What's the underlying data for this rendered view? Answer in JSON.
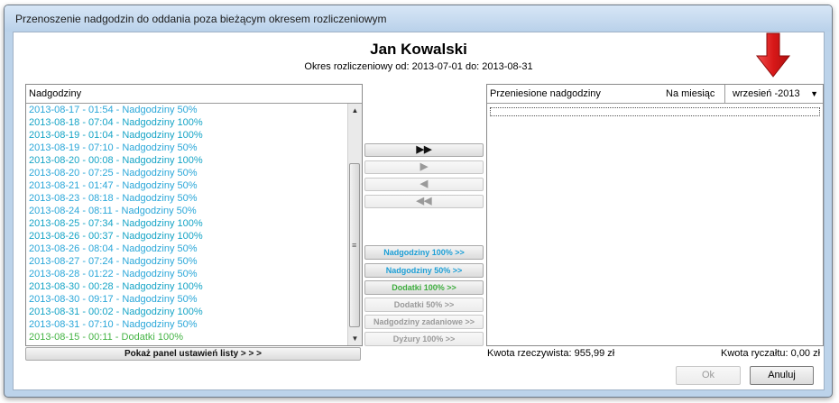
{
  "window": {
    "title": "Przenoszenie nadgodzin do oddania poza bieżącym okresem rozliczeniowym"
  },
  "header": {
    "name": "Jan Kowalski",
    "period": "Okres rozliczeniowy od: 2013-07-01 do: 2013-08-31"
  },
  "left_panel": {
    "title": "Nadgodziny",
    "items": [
      {
        "text": "2013-08-17 - 01:54 - Nadgodziny 50%",
        "kind": "c50"
      },
      {
        "text": "2013-08-18 - 07:04 - Nadgodziny 100%",
        "kind": "c100"
      },
      {
        "text": "2013-08-19 - 01:04 - Nadgodziny 100%",
        "kind": "c100"
      },
      {
        "text": "2013-08-19 - 07:10 - Nadgodziny 50%",
        "kind": "c50"
      },
      {
        "text": "2013-08-20 - 00:08 - Nadgodziny 100%",
        "kind": "c100"
      },
      {
        "text": "2013-08-20 - 07:25 - Nadgodziny 50%",
        "kind": "c50"
      },
      {
        "text": "2013-08-21 - 01:47 - Nadgodziny 50%",
        "kind": "c50"
      },
      {
        "text": "2013-08-23 - 08:18 - Nadgodziny 50%",
        "kind": "c50"
      },
      {
        "text": "2013-08-24 - 08:11 - Nadgodziny 50%",
        "kind": "c50"
      },
      {
        "text": "2013-08-25 - 07:34 - Nadgodziny 100%",
        "kind": "c100"
      },
      {
        "text": "2013-08-26 - 00:37 - Nadgodziny 100%",
        "kind": "c100"
      },
      {
        "text": "2013-08-26 - 08:04 - Nadgodziny 50%",
        "kind": "c50"
      },
      {
        "text": "2013-08-27 - 07:24 - Nadgodziny 50%",
        "kind": "c50"
      },
      {
        "text": "2013-08-28 - 01:22 - Nadgodziny 50%",
        "kind": "c50"
      },
      {
        "text": "2013-08-30 - 00:28 - Nadgodziny 100%",
        "kind": "c100"
      },
      {
        "text": "2013-08-30 - 09:17 - Nadgodziny 50%",
        "kind": "c50"
      },
      {
        "text": "2013-08-31 - 00:02 - Nadgodziny 100%",
        "kind": "c100"
      },
      {
        "text": "2013-08-31 - 07:10 - Nadgodziny 50%",
        "kind": "c50"
      },
      {
        "text": "2013-08-15 - 00:11 - Dodatki 100%",
        "kind": "cdod"
      }
    ],
    "show_settings_button": "Pokaż panel ustawień listy > > >"
  },
  "move_buttons": {
    "all_right": "▶▶",
    "right": "▶",
    "left": "◀",
    "all_left": "◀◀"
  },
  "category_buttons": [
    {
      "label": "Nadgodziny 100% >>",
      "color": "t-blue",
      "enabled": true
    },
    {
      "label": "Nadgodziny 50% >>",
      "color": "t-blue",
      "enabled": true
    },
    {
      "label": "Dodatki 100% >>",
      "color": "t-green",
      "enabled": true
    },
    {
      "label": "Dodatki 50% >>",
      "color": "t-grey",
      "enabled": false
    },
    {
      "label": "Nadgodziny zadaniowe >>",
      "color": "t-grey",
      "enabled": false
    },
    {
      "label": "Dyżury 100% >>",
      "color": "t-grey",
      "enabled": false
    }
  ],
  "right_panel": {
    "title": "Przeniesione nadgodziny",
    "month_label": "Na miesiąc",
    "month_value": "wrzesień  -2013",
    "caret": "▼"
  },
  "footer": {
    "actual_amount": "Kwota rzeczywista: 955,99 zł",
    "lump_amount": "Kwota ryczałtu: 0,00 zł"
  },
  "dialog_buttons": {
    "ok": "Ok",
    "cancel": "Anuluj"
  },
  "colors": {
    "accent_blue": "#15a4c6",
    "accent_green": "#45b445",
    "highlight_arrow": "#e02020"
  }
}
